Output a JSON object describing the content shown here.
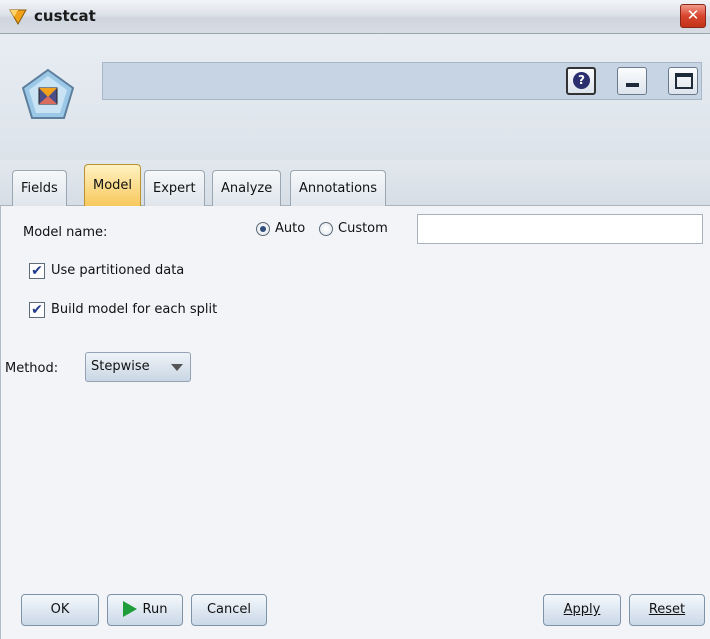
{
  "window": {
    "title": "custcat",
    "close_label": "✕"
  },
  "toolbar": {
    "help_label": "?"
  },
  "tabs": [
    {
      "label": "Fields",
      "active": false
    },
    {
      "label": "Model",
      "active": true
    },
    {
      "label": "Expert",
      "active": false
    },
    {
      "label": "Analyze",
      "active": false
    },
    {
      "label": "Annotations",
      "active": false
    }
  ],
  "model": {
    "name_label": "Model name:",
    "auto_label": "Auto",
    "custom_label": "Custom",
    "name_mode": "Auto",
    "custom_name_value": "",
    "use_partitioned_label": "Use partitioned data",
    "use_partitioned_checked": true,
    "build_split_label": "Build model for each split",
    "build_split_checked": true,
    "method_label": "Method:",
    "method_value": "Stepwise"
  },
  "buttons": {
    "ok": "OK",
    "run": "Run",
    "cancel": "Cancel",
    "apply": "Apply",
    "reset": "Reset"
  },
  "colors": {
    "active_tab": "#f7c85c",
    "close_button": "#d8442d",
    "run_arrow": "#1f9d3a"
  }
}
